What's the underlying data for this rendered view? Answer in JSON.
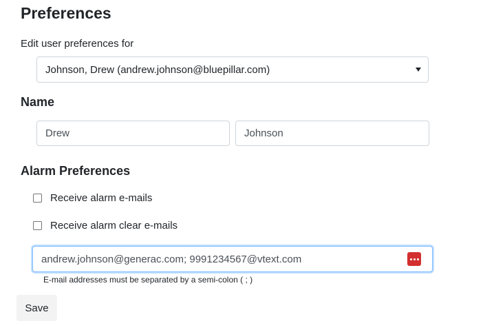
{
  "page": {
    "title": "Preferences"
  },
  "user_select": {
    "label": "Edit user preferences for",
    "selected": "Johnson, Drew (andrew.johnson@bluepillar.com)"
  },
  "name_section": {
    "heading": "Name",
    "first_name": "Drew",
    "last_name": "Johnson"
  },
  "alarm_section": {
    "heading": "Alarm Preferences",
    "receive_alarm_emails_label": "Receive alarm e-mails",
    "receive_alarm_emails_checked": false,
    "receive_alarm_clear_emails_label": "Receive alarm clear e-mails",
    "receive_alarm_clear_emails_checked": false,
    "email_addresses": "andrew.johnson@generac.com; 9991234567@vtext.com",
    "email_help": "E-mail addresses must be separated by a semi-colon ( ; )",
    "field_icon": "password-manager-dots-icon",
    "field_icon_color": "#d32f2f",
    "focus_color": "#80bdff"
  },
  "actions": {
    "save_label": "Save"
  }
}
